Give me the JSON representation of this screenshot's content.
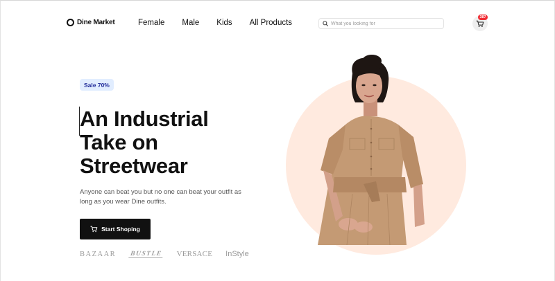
{
  "header": {
    "logo_text": "Dine Market",
    "nav": [
      "Female",
      "Male",
      "Kids",
      "All Products"
    ],
    "search_placeholder": "What you looking for",
    "cart_count": "387"
  },
  "hero": {
    "badge": "Sale 70%",
    "title_lines": [
      "An Industrial",
      "Take on",
      "Streetwear"
    ],
    "description": "Anyone can beat you but no one can beat your outfit as long as you wear Dine outfits.",
    "cta_label": "Start Shoping"
  },
  "brands": [
    "BAZAAR",
    "BUSTLE",
    "VERSACE",
    "InStyle"
  ],
  "colors": {
    "badge_bg": "#e1edff",
    "badge_text": "#212c9a",
    "circle": "#ffeadf",
    "cart_badge": "#f02d34",
    "cta_bg": "#111111"
  },
  "icons": {
    "logo": "ring-logo-icon",
    "search": "search-icon",
    "cart": "shopping-cart-icon",
    "cta": "cart-icon"
  }
}
